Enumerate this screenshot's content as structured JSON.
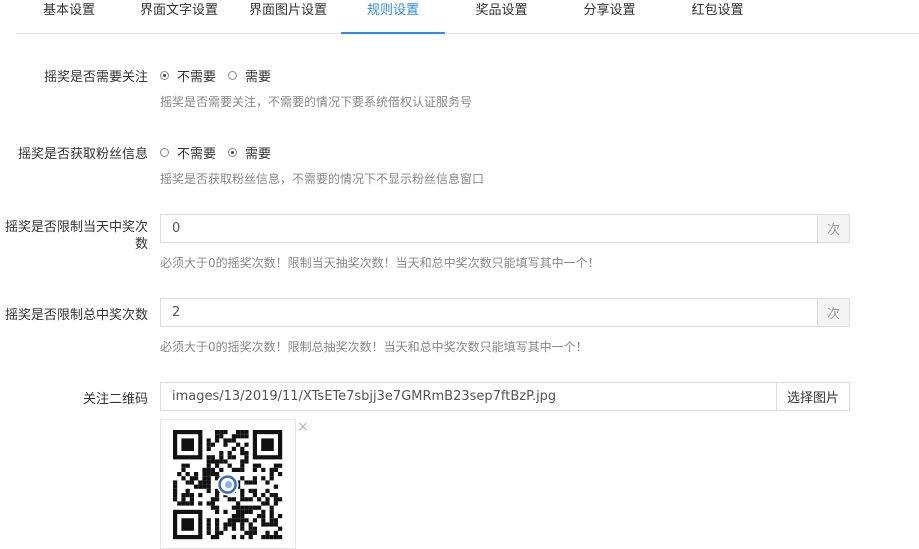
{
  "tabs": [
    {
      "label": "基本设置",
      "active": false
    },
    {
      "label": "界面文字设置",
      "active": false
    },
    {
      "label": "界面图片设置",
      "active": false
    },
    {
      "label": "规则设置",
      "active": true
    },
    {
      "label": "奖品设置",
      "active": false
    },
    {
      "label": "分享设置",
      "active": false
    },
    {
      "label": "红包设置",
      "active": false
    }
  ],
  "form": {
    "follow": {
      "label": "摇奖是否需要关注",
      "options": [
        "不需要",
        "需要"
      ],
      "selected": "不需要",
      "help": "摇奖是否需要关注，不需要的情况下要系统借权认证服务号"
    },
    "fans_info": {
      "label": "摇奖是否获取粉丝信息",
      "options": [
        "不需要",
        "需要"
      ],
      "selected": "需要",
      "help": "摇奖是否获取粉丝信息，不需要的情况下不显示粉丝信息窗口"
    },
    "daily_limit": {
      "label": "摇奖是否限制当天中奖次数",
      "value": "0",
      "addon": "次",
      "help": "必须大于0的摇奖次数！限制当天抽奖次数！当天和总中奖次数只能填写其中一个！"
    },
    "total_limit": {
      "label": "摇奖是否限制总中奖次数",
      "value": "2",
      "addon": "次",
      "help": "必须大于0的摇奖次数！限制总抽奖次数！当天和总中奖次数只能填写其中一个！"
    },
    "qrcode": {
      "label": "关注二维码",
      "value": "images/13/2019/11/XTsETe7sbjj3e7GMRmB23sep7ftBzP.jpg",
      "button": "选择图片",
      "remove": "×"
    }
  },
  "colors": {
    "accent": "#2d8cf0",
    "text": "#333333",
    "help": "#888888",
    "border": "#dcdcdc"
  },
  "icons": {
    "qrcode": "qr-code-image",
    "remove": "close-icon"
  }
}
